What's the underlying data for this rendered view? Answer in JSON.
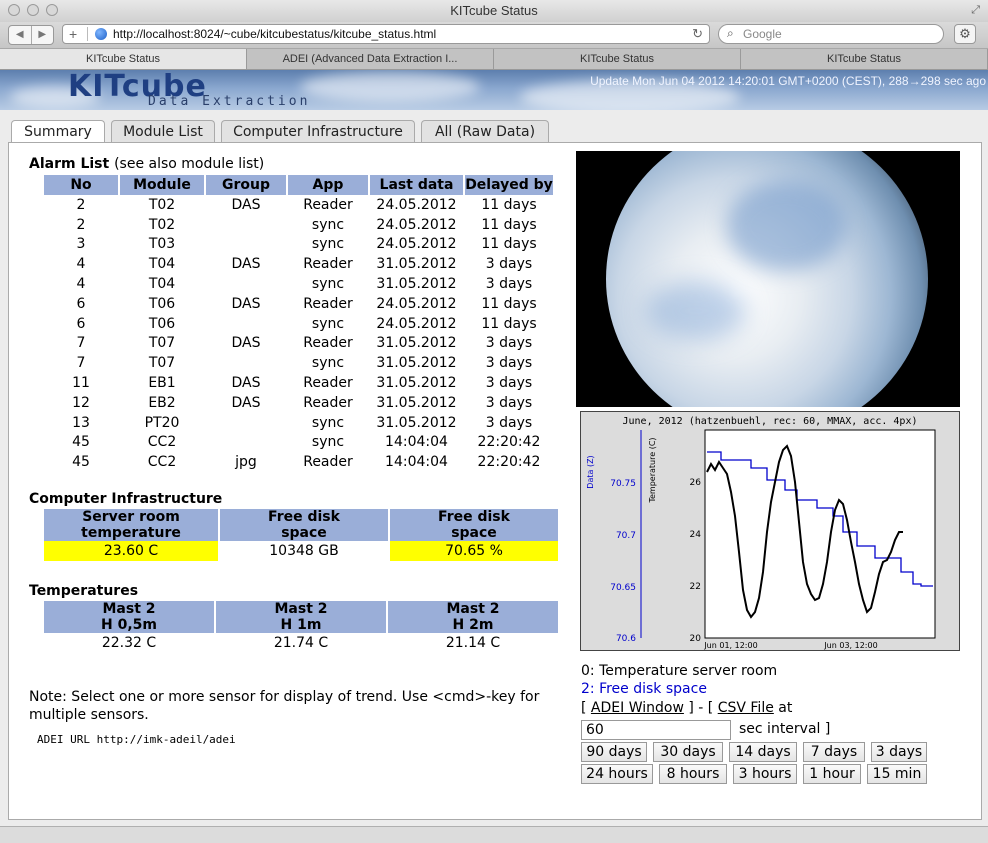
{
  "window": {
    "title": "KITcube Status"
  },
  "browser": {
    "url": "http://localhost:8024/~cube/kitcubestatus/kitcube_status.html",
    "search_placeholder": "Google",
    "tabs": [
      "KITcube Status",
      "ADEI (Advanced Data Extraction I...",
      "KITcube Status",
      "KITcube Status"
    ]
  },
  "banner": {
    "logo": "KITcube",
    "logo_sub": "Data Extraction",
    "update": "Update Mon Jun 04 2012 14:20:01 GMT+0200 (CEST), 288→298 sec ago"
  },
  "page_tabs": [
    "Summary",
    "Module List",
    "Computer Infrastructure",
    "All (Raw Data)"
  ],
  "alarm": {
    "title": "Alarm List",
    "hint": "(see also module list)",
    "headers": [
      "No",
      "Module",
      "Group",
      "App",
      "Last data",
      "Delayed by"
    ],
    "rows": [
      [
        "2",
        "T02",
        "DAS",
        "Reader",
        "24.05.2012",
        "11 days"
      ],
      [
        "2",
        "T02",
        "",
        "sync",
        "24.05.2012",
        "11 days"
      ],
      [
        "3",
        "T03",
        "",
        "sync",
        "24.05.2012",
        "11 days"
      ],
      [
        "4",
        "T04",
        "DAS",
        "Reader",
        "31.05.2012",
        "3 days"
      ],
      [
        "4",
        "T04",
        "",
        "sync",
        "31.05.2012",
        "3 days"
      ],
      [
        "6",
        "T06",
        "DAS",
        "Reader",
        "24.05.2012",
        "11 days"
      ],
      [
        "6",
        "T06",
        "",
        "sync",
        "24.05.2012",
        "11 days"
      ],
      [
        "7",
        "T07",
        "DAS",
        "Reader",
        "31.05.2012",
        "3 days"
      ],
      [
        "7",
        "T07",
        "",
        "sync",
        "31.05.2012",
        "3 days"
      ],
      [
        "11",
        "EB1",
        "DAS",
        "Reader",
        "31.05.2012",
        "3 days"
      ],
      [
        "12",
        "EB2",
        "DAS",
        "Reader",
        "31.05.2012",
        "3 days"
      ],
      [
        "13",
        "PT20",
        "",
        "sync",
        "31.05.2012",
        "3 days"
      ],
      [
        "45",
        "CC2",
        "",
        "sync",
        "14:04:04",
        "22:20:42"
      ],
      [
        "45",
        "CC2",
        "jpg",
        "Reader",
        "14:04:04",
        "22:20:42"
      ]
    ]
  },
  "infra": {
    "title": "Computer Infrastructure",
    "headers": [
      [
        "Server room",
        "temperature"
      ],
      [
        "Free disk",
        "space"
      ],
      [
        "Free disk",
        "space"
      ]
    ],
    "values": [
      "23.60 C",
      "10348 GB",
      "70.65 %"
    ]
  },
  "temps": {
    "title": "Temperatures",
    "headers": [
      [
        "Mast 2",
        "H 0,5m"
      ],
      [
        "Mast 2",
        "H 1m"
      ],
      [
        "Mast 2",
        "H 2m"
      ]
    ],
    "values": [
      "22.32 C",
      "21.74 C",
      "21.14 C"
    ]
  },
  "note": "Note: Select one or more sensor for display of trend. Use <cmd>-key for multiple sensors.",
  "adei_url": "ADEI URL http://imk-adeil/adei",
  "plot": {
    "title": "June, 2012 (hatzenbuehl, rec: 60, MMAX, acc. 4px)",
    "left_axis_label": "Data (Z)",
    "left_ticks": [
      "70.75",
      "70.7",
      "70.65",
      "70.6"
    ],
    "right_axis_label": "Temperature (C)",
    "right_ticks": [
      "26",
      "24",
      "22",
      "20"
    ],
    "x_ticks": [
      "Jun 01, 12:00",
      "Jun 03, 12:00"
    ],
    "colors": {
      "series0": "#000000",
      "series2": "#0000cc"
    }
  },
  "legend": {
    "s0": "0: Temperature server room",
    "s2": "2: Free disk space"
  },
  "controls": {
    "bracket_open": "[",
    "adei_window": "ADEI Window",
    "sep": "] - [",
    "csv_file": "CSV File",
    "at": "at",
    "interval_value": "60",
    "interval_suffix": "sec interval ]",
    "range_row1": [
      "90 days",
      "30 days",
      "14 days",
      "7 days",
      "3 days"
    ],
    "range_row2": [
      "24 hours",
      "8 hours",
      "3 hours",
      "1 hour",
      "15 min"
    ]
  }
}
